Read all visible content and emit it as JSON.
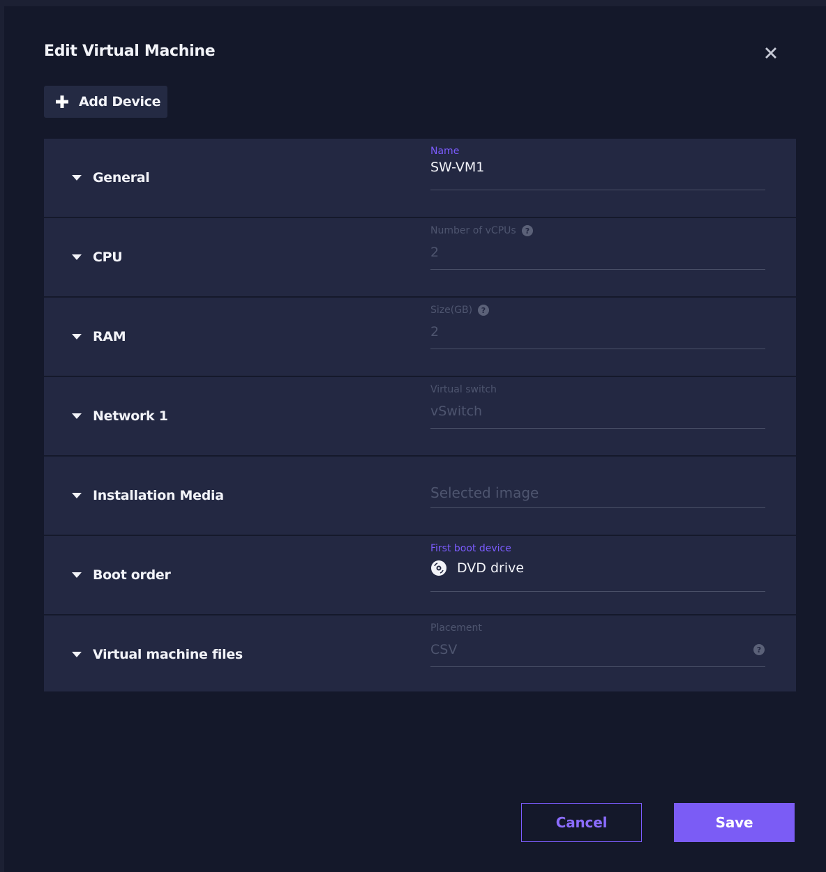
{
  "dialog": {
    "title": "Edit Virtual Machine",
    "close_icon": "close-icon",
    "add_device_label": "Add Device",
    "accent_color": "#7c5cff"
  },
  "sections": [
    {
      "title": "General",
      "field_label": "Name",
      "field_value": "SW-VM1",
      "value_state": "filled"
    },
    {
      "title": "CPU",
      "field_label": "Number of vCPUs",
      "field_value": "2",
      "value_state": "disabled",
      "help_icon": "help-icon"
    },
    {
      "title": "RAM",
      "field_label": "Size(GB)",
      "field_value": "2",
      "value_state": "disabled",
      "help_icon": "help-icon"
    },
    {
      "title": "Network 1",
      "field_label": "Virtual switch",
      "field_value": "vSwitch",
      "value_state": "disabled"
    },
    {
      "title": "Installation Media",
      "field_placeholder": "Selected image"
    },
    {
      "title": "Boot order",
      "field_label": "First boot device",
      "field_value": "DVD drive",
      "value_state": "filled",
      "value_icon": "disc-icon"
    },
    {
      "title": "Virtual machine files",
      "field_label": "Placement",
      "field_value": "CSV",
      "value_state": "disabled",
      "help_icon": "help-icon"
    }
  ],
  "footer": {
    "cancel_label": "Cancel",
    "save_label": "Save"
  }
}
